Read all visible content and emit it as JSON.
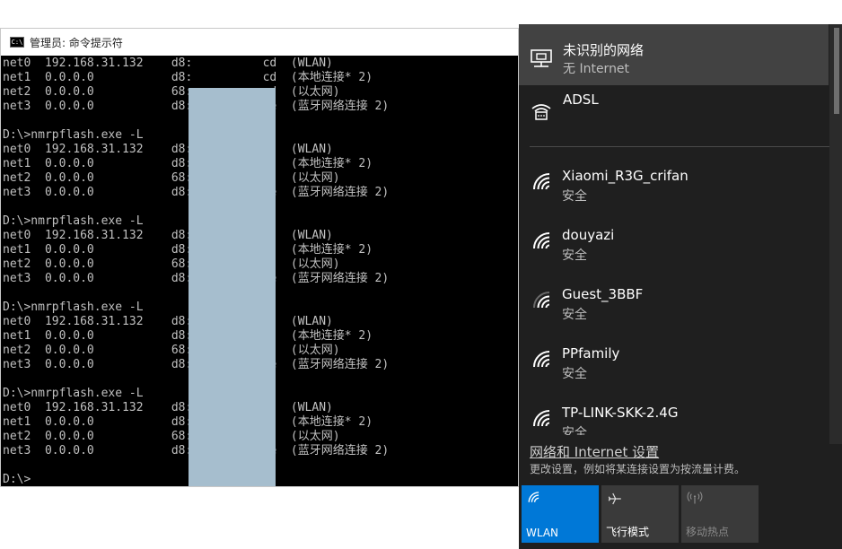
{
  "cmd": {
    "title": "管理员: 命令提示符",
    "icon": "C:\\",
    "lines": [
      "net0  192.168.31.132    d8:          cd  (WLAN)",
      "net1  0.0.0.0           d8:          cd  (本地连接* 2)",
      "net2  0.0.0.0           68:          ed  (以太网)",
      "net3  0.0.0.0           d8:          ce  (蓝牙网络连接 2)",
      "",
      "D:\\>nmrpflash.exe -L",
      "net0  192.168.31.132    d8:          cd  (WLAN)",
      "net1  0.0.0.0           d8:          cd  (本地连接* 2)",
      "net2  0.0.0.0           68:          ed  (以太网)",
      "net3  0.0.0.0           d8:          ce  (蓝牙网络连接 2)",
      "",
      "D:\\>nmrpflash.exe -L",
      "net0  192.168.31.132    d8:          cd  (WLAN)",
      "net1  0.0.0.0           d8:          cd  (本地连接* 2)",
      "net2  0.0.0.0           68:          ed  (以太网)",
      "net3  0.0.0.0           d8:          ce  (蓝牙网络连接 2)",
      "",
      "D:\\>nmrpflash.exe -L",
      "net0  192.168.31.132    d8:          cd  (WLAN)",
      "net1  0.0.0.0           d8:          cd  (本地连接* 2)",
      "net2  0.0.0.0           68:          ed  (以太网)",
      "net3  0.0.0.0           d8:          ce  (蓝牙网络连接 2)",
      "",
      "D:\\>nmrpflash.exe -L",
      "net0  192.168.31.132    d8:          cd  (WLAN)",
      "net1  0.0.0.0           d8:          cd  (本地连接* 2)",
      "net2  0.0.0.0           68:          ed  (以太网)",
      "net3  0.0.0.0           d8:          ce  (蓝牙网络连接 2)",
      "",
      "D:\\>"
    ]
  },
  "flyout": {
    "current": {
      "name": "未识别的网络",
      "status": "无 Internet",
      "icon": "ethernet-icon"
    },
    "adsl": {
      "name": "ADSL",
      "icon": "dialup-icon"
    },
    "wifi": [
      {
        "name": "Xiaomi_R3G_crifan",
        "status": "安全",
        "icon": "wifi-full-icon"
      },
      {
        "name": "douyazi",
        "status": "安全",
        "icon": "wifi-full-icon"
      },
      {
        "name": "Guest_3BBF",
        "status": "安全",
        "icon": "wifi-partial-icon"
      },
      {
        "name": "PPfamily",
        "status": "安全",
        "icon": "wifi-full-icon"
      },
      {
        "name": "TP-LINK-SKK-2.4G",
        "status": "安全",
        "icon": "wifi-full-icon"
      }
    ],
    "settings_link": "网络和 Internet 设置",
    "settings_desc": "更改设置，例如将某连接设置为按流量计费。",
    "quick_actions": [
      {
        "label": "WLAN",
        "icon": "wifi-icon",
        "active": true
      },
      {
        "label": "飞行模式",
        "icon": "airplane-icon",
        "active": false
      },
      {
        "label": "移动热点",
        "icon": "hotspot-icon",
        "active": false
      }
    ]
  },
  "colors": {
    "console_bg": "#000000",
    "console_text": "#c0c0c0",
    "redaction": "#a6bece",
    "flyout_bg": "#1f1f1f",
    "selected_row": "#424242",
    "accent": "#0078d7",
    "tile_inactive": "#3a3a3a"
  }
}
